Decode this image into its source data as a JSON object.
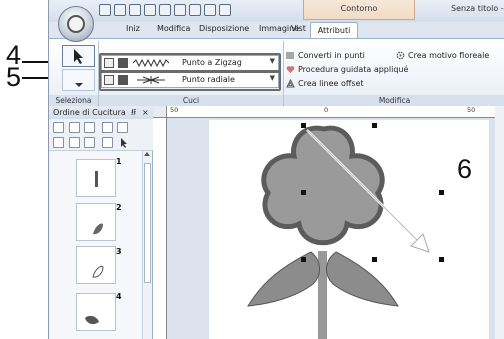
{
  "callouts": [
    "4",
    "5",
    "6"
  ],
  "window": {
    "title": "Senza titolo - La",
    "context_tab": "Contorno"
  },
  "tabs": [
    "Iniz",
    "Modifica",
    "Disposizione",
    "Immagine",
    "Vist",
    "Attributi"
  ],
  "ribbon": {
    "groups": [
      "Seleziona",
      "Cuci",
      "Modifica"
    ],
    "line_stitch": "Punto a Zigzag",
    "region_stitch": "Punto radiale",
    "commands": {
      "convert": "Converti in punti",
      "applique": "Procedura guidata appliqué",
      "offset": "Crea linee offset",
      "floral": "Crea motivo floreale"
    }
  },
  "sewing_order": {
    "title": "Ordine di Cucitura",
    "pin": "⭿",
    "close": "×",
    "items": [
      "1",
      "2",
      "3",
      "4"
    ]
  },
  "ruler": {
    "top_labels": [
      "50",
      "0",
      "50"
    ]
  },
  "colors": {
    "petal_fill": "#9a9a9a",
    "petal_outline": "#5c5c5c",
    "leaf_fill": "#8c8c8c",
    "stem": "#999999"
  }
}
